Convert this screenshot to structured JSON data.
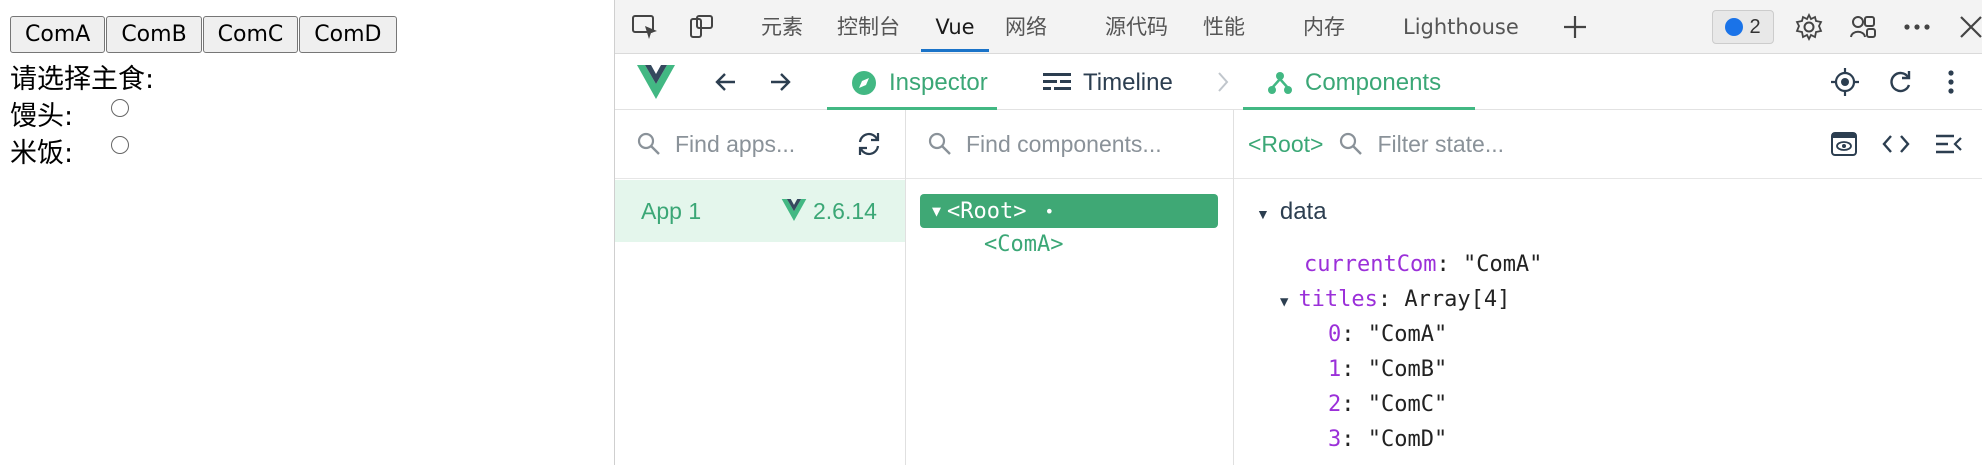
{
  "page": {
    "buttons": [
      "ComA",
      "ComB",
      "ComC",
      "ComD"
    ],
    "prompt": "请选择主食:",
    "options": [
      {
        "label": "馒头:"
      },
      {
        "label": "米饭:"
      }
    ]
  },
  "devtools": {
    "tabs": [
      "元素",
      "控制台",
      "Vue",
      "网络",
      "源代码",
      "性能",
      "内存",
      "Lighthouse"
    ],
    "active_tab": "Vue",
    "issues_count": "2",
    "icons": [
      "inspect-element-icon",
      "device-toolbar-icon",
      "add-tab-icon",
      "issues-icon",
      "settings-icon",
      "connections-icon",
      "more-icon",
      "close-icon"
    ]
  },
  "vue": {
    "nav": {
      "inspector": "Inspector",
      "timeline": "Timeline",
      "components": "Components"
    },
    "apps": {
      "search_placeholder": "Find apps...",
      "items": [
        {
          "name": "App 1",
          "version": "2.6.14"
        }
      ]
    },
    "components": {
      "search_placeholder": "Find components...",
      "root": "<Root>",
      "child": "<ComA>"
    },
    "state": {
      "selected": "<Root>",
      "filter_placeholder": "Filter state...",
      "section": "data",
      "currentCom_key": "currentCom",
      "currentCom_value": "\"ComA\"",
      "titles_key": "titles",
      "titles_type": "Array[4]",
      "titles": [
        {
          "index": "0",
          "value": "\"ComA\""
        },
        {
          "index": "1",
          "value": "\"ComB\""
        },
        {
          "index": "2",
          "value": "\"ComC\""
        },
        {
          "index": "3",
          "value": "\"ComD\""
        }
      ]
    },
    "colors": {
      "accent": "#42b883",
      "key": "#9b30d9",
      "selected_bg": "#3fa875"
    }
  }
}
